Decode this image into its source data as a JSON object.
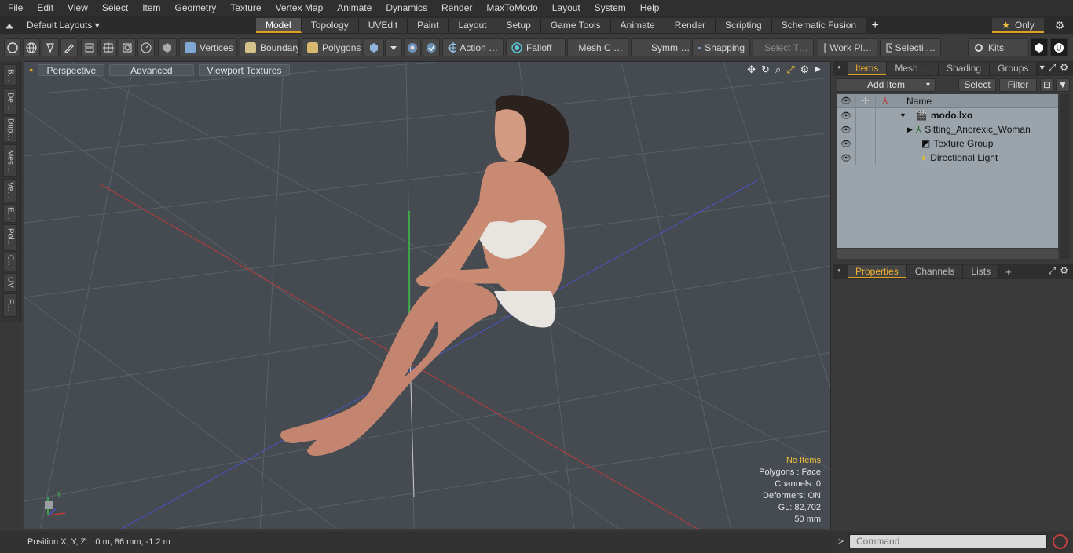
{
  "menu": [
    "File",
    "Edit",
    "View",
    "Select",
    "Item",
    "Geometry",
    "Texture",
    "Vertex Map",
    "Animate",
    "Dynamics",
    "Render",
    "MaxToModo",
    "Layout",
    "System",
    "Help"
  ],
  "layout_selector": "Default Layouts ▾",
  "layout_tabs": [
    "Model",
    "Topology",
    "UVEdit",
    "Paint",
    "Layout",
    "Setup",
    "Game Tools",
    "Animate",
    "Render",
    "Scripting",
    "Schematic Fusion"
  ],
  "layout_tab_active": "Model",
  "only_label": "Only",
  "toolbar": {
    "vertices": "Vertices",
    "boundary": "Boundary",
    "polygons": "Polygons",
    "action": "Action …",
    "falloff": "Falloff",
    "mesh_c": "Mesh C …",
    "symm": "Symm …",
    "snapping": "Snapping",
    "select_t": "Select T…",
    "work_pl": "Work Pl…",
    "selecti": "Selecti …",
    "kits": "Kits"
  },
  "left_tabs": [
    "B…",
    "De…",
    "Dup…",
    "Mes…",
    "Ve…",
    "E…",
    "Pol…",
    "C…",
    "UV",
    "F…"
  ],
  "viewport": {
    "perspective": "Perspective",
    "advanced": "Advanced",
    "viewport_textures": "Viewport Textures",
    "axis_y": "Y",
    "info": {
      "selection": "No Items",
      "polygons": "Polygons : Face",
      "channels": "Channels: 0",
      "deformers": "Deformers: ON",
      "gl": "GL: 82,702",
      "focal": "50 mm"
    }
  },
  "status": "Position X, Y, Z:   0 m, 86 mm, -1.2 m",
  "items_panel": {
    "tabs": [
      "Items",
      "Mesh …",
      "Shading",
      "Groups"
    ],
    "active_tab": "Items",
    "add_item": "Add Item",
    "select": "Select",
    "filter": "Filter",
    "name_header": "Name",
    "rows": [
      {
        "name": "modo.lxo"
      },
      {
        "name": "Sitting_Anorexic_Woman"
      },
      {
        "name": "Texture Group"
      },
      {
        "name": "Directional Light"
      }
    ]
  },
  "properties_panel": {
    "tabs": [
      "Properties",
      "Channels",
      "Lists"
    ],
    "active_tab": "Properties"
  },
  "command": {
    "placeholder": "Command",
    "prompt": ">"
  },
  "colors": {
    "accent": "#e0a020",
    "viewport_bg": "#454b50",
    "tree_bg": "#9ca4ab"
  }
}
